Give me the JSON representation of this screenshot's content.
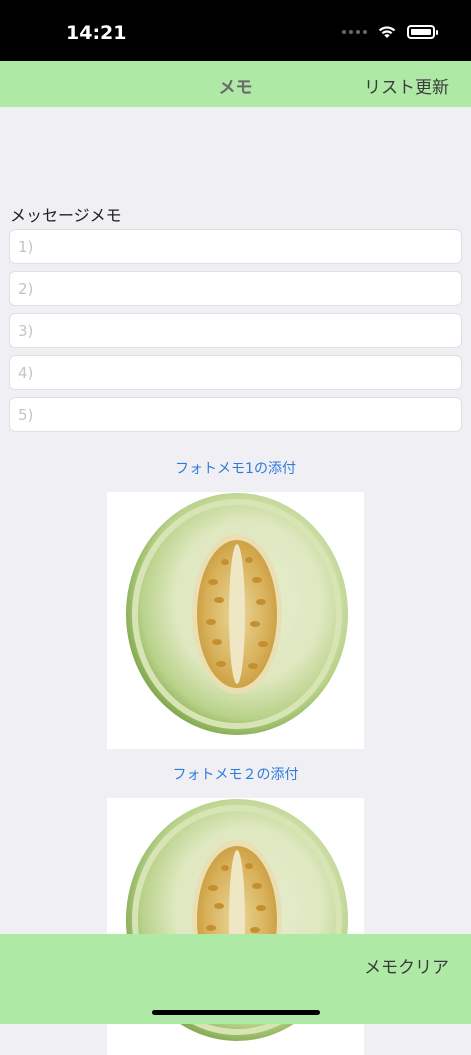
{
  "status": {
    "time": "14:21"
  },
  "nav": {
    "title": "メモ",
    "right_button": "リスト更新"
  },
  "message_memo": {
    "label": "メッセージメモ",
    "placeholders": [
      "1)",
      "2)",
      "3)",
      "4)",
      "5)"
    ]
  },
  "photos": [
    {
      "link": "フォトメモ1の添付",
      "image": "melon-photo"
    },
    {
      "link": "フォトメモ２の添付",
      "image": "melon-photo"
    }
  ],
  "bottom": {
    "right_button": "メモクリア"
  },
  "colors": {
    "bar": "#aeeaa5",
    "link": "#2f7bdc",
    "background": "#efeff4"
  }
}
